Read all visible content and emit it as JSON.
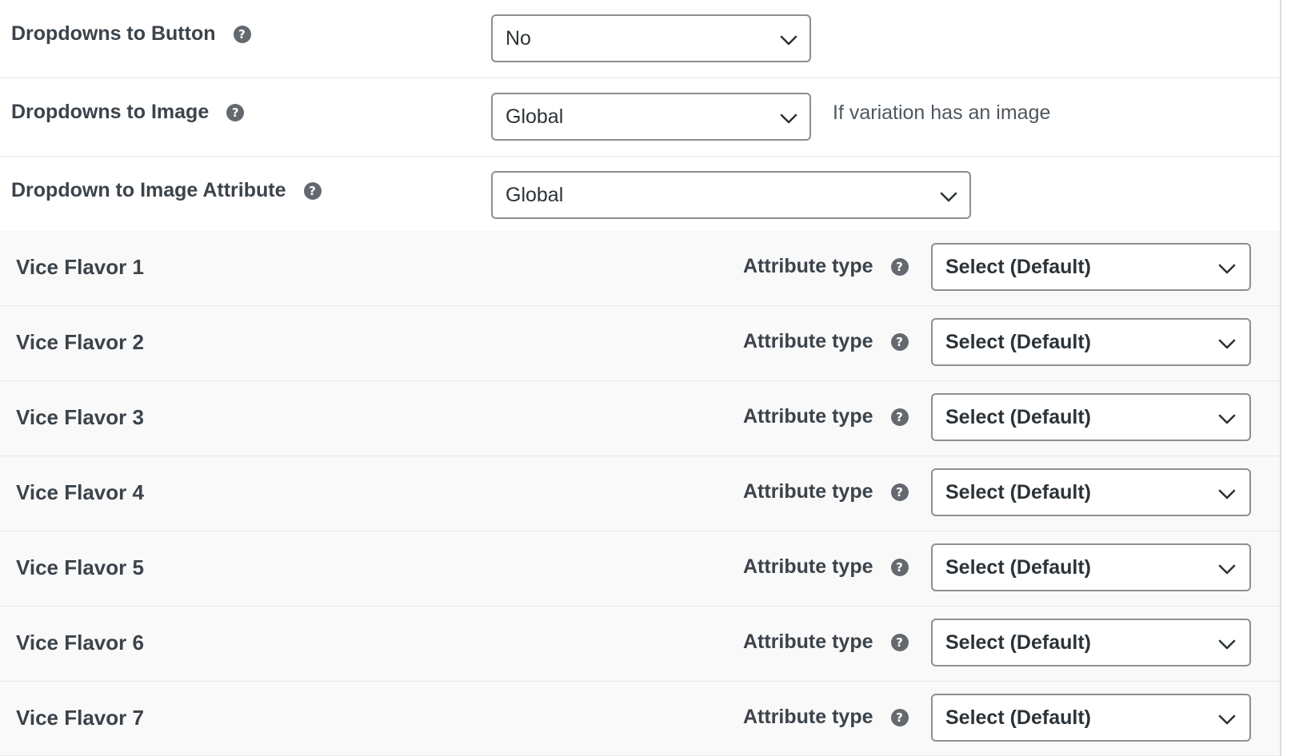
{
  "options": [
    {
      "label": "Dropdowns to Button",
      "value": "No",
      "hint": ""
    },
    {
      "label": "Dropdowns to Image",
      "value": "Global",
      "hint": "If variation has an image"
    },
    {
      "label": "Dropdown to Image Attribute",
      "value": "Global",
      "hint": ""
    }
  ],
  "help_glyph": "?",
  "attributes": {
    "type_label": "Attribute type",
    "rows": [
      {
        "name": "Vice Flavor 1",
        "value": "Select (Default)"
      },
      {
        "name": "Vice Flavor 2",
        "value": "Select (Default)"
      },
      {
        "name": "Vice Flavor 3",
        "value": "Select (Default)"
      },
      {
        "name": "Vice Flavor 4",
        "value": "Select (Default)"
      },
      {
        "name": "Vice Flavor 5",
        "value": "Select (Default)"
      },
      {
        "name": "Vice Flavor 6",
        "value": "Select (Default)"
      },
      {
        "name": "Vice Flavor 7",
        "value": "Select (Default)"
      }
    ]
  },
  "colors": {
    "help_icon": "#646970",
    "row_bg": "#f9f9f9",
    "border": "#8c8f94"
  }
}
